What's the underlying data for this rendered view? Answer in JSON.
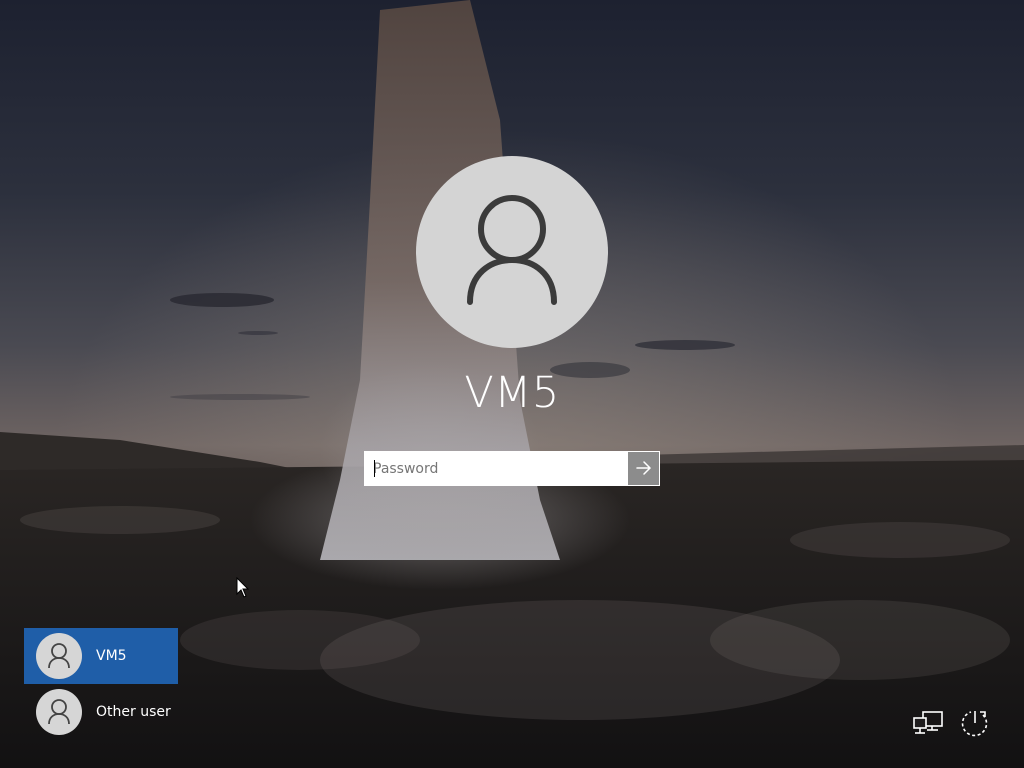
{
  "login": {
    "username": "VM5",
    "password_placeholder": "Password"
  },
  "user_list": [
    {
      "label": "VM5",
      "selected": true
    },
    {
      "label": "Other user",
      "selected": false
    }
  ],
  "icons": {
    "avatar": "user-icon",
    "submit": "arrow-right-icon",
    "network": "network-icon",
    "power": "power-icon",
    "cursor": "mouse-pointer-icon"
  },
  "colors": {
    "selected_tile": "#1f5ea8",
    "avatar_bg": "#d4d4d4",
    "submit_bg": "#8c8c8c"
  }
}
